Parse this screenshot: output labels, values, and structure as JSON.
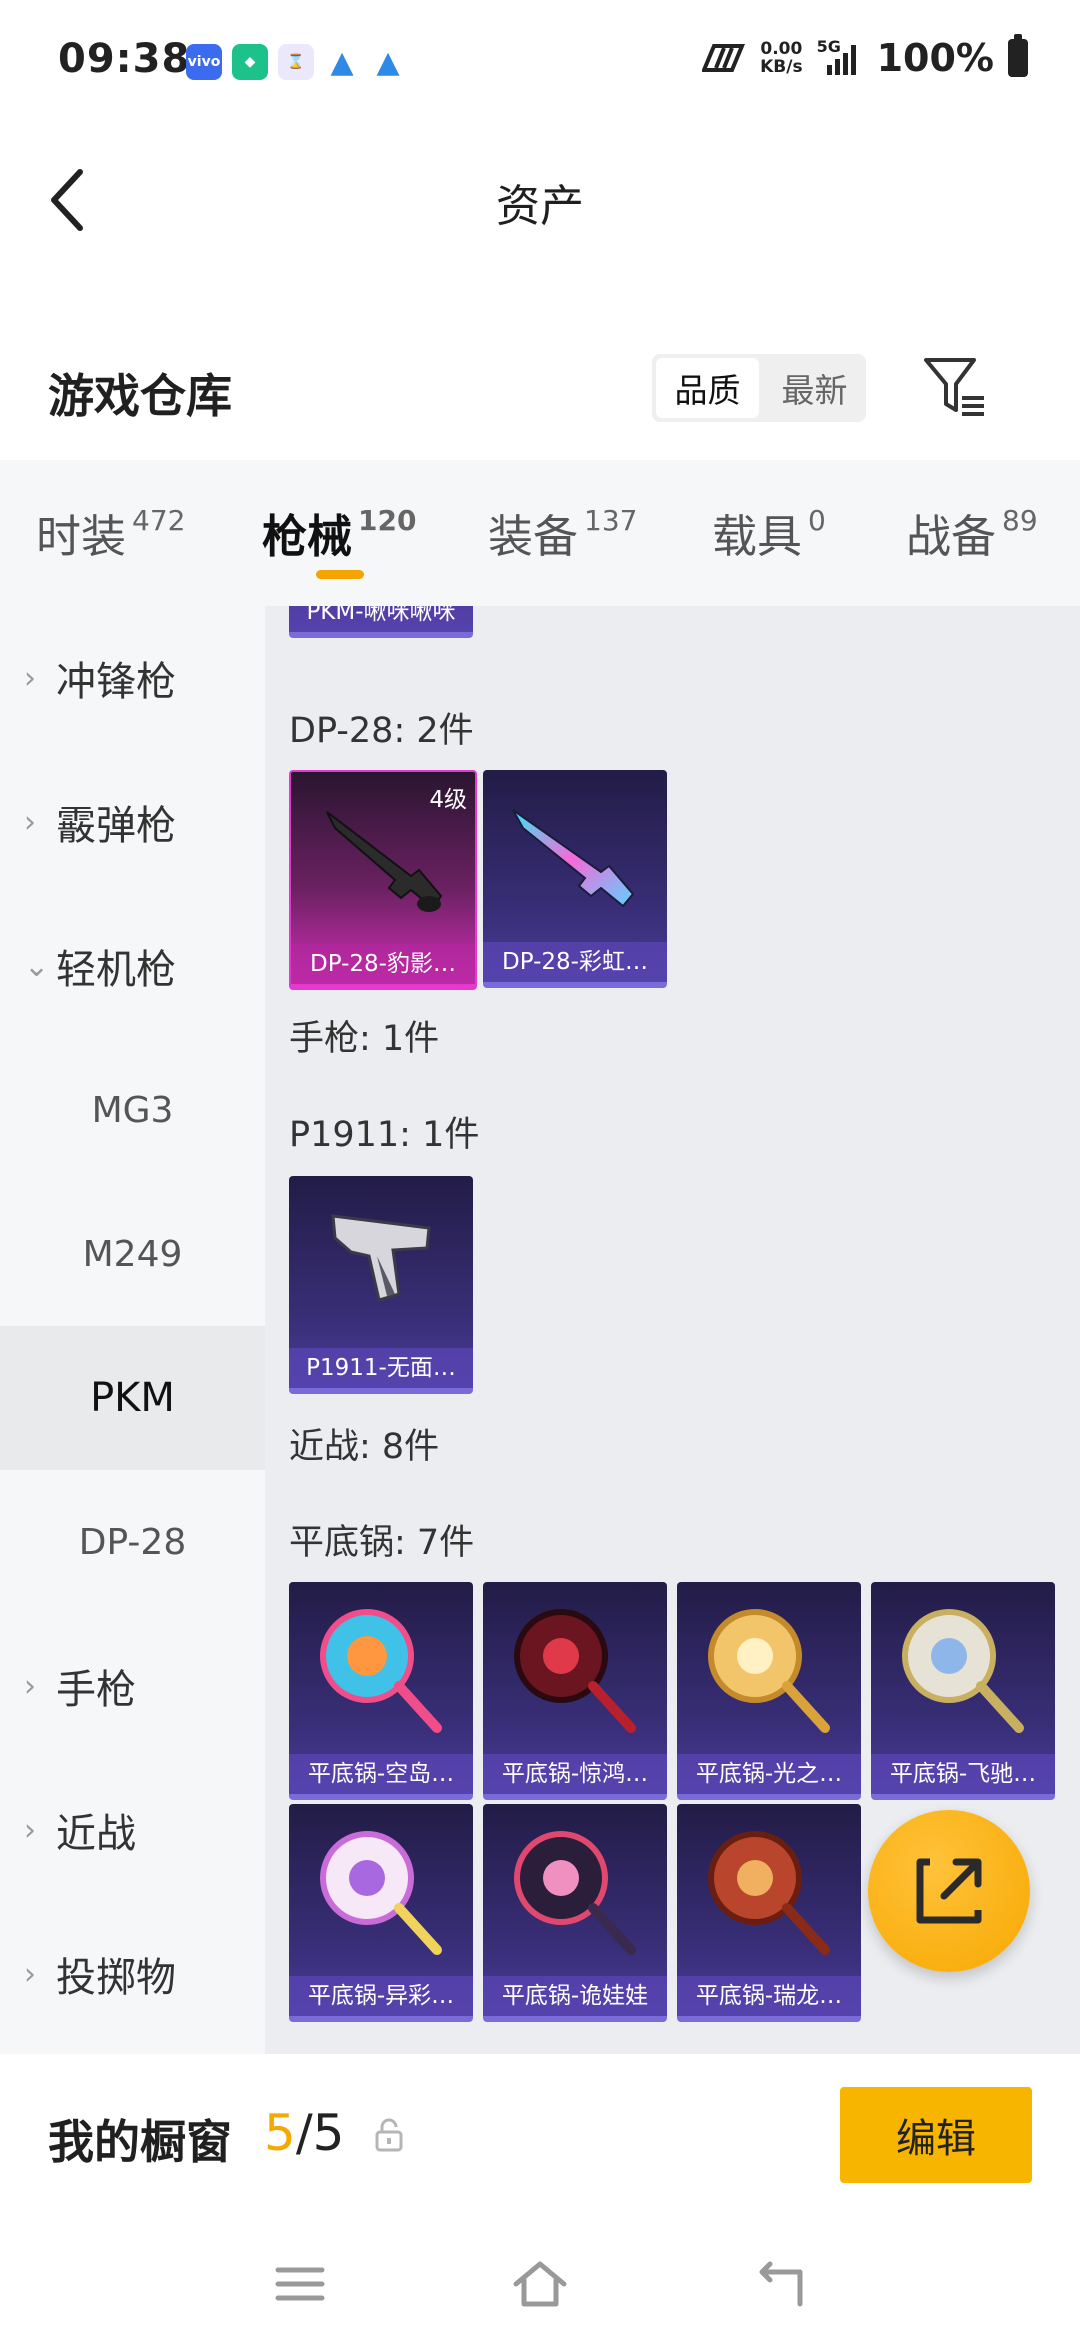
{
  "status": {
    "time": "09:38",
    "speed_value": "0.00",
    "speed_unit": "KB/s",
    "network": "5G",
    "battery": "100%"
  },
  "header": {
    "title": "资产"
  },
  "warehouse": {
    "title": "游戏仓库",
    "sort_options": [
      "品质",
      "最新"
    ],
    "active_sort": "品质"
  },
  "tabs": [
    {
      "label": "时装",
      "count": "472"
    },
    {
      "label": "枪械",
      "count": "120",
      "active": true
    },
    {
      "label": "装备",
      "count": "137"
    },
    {
      "label": "载具",
      "count": "0"
    },
    {
      "label": "战备",
      "count": "89"
    }
  ],
  "sidebar": [
    {
      "label": "冲锋枪",
      "type": "group"
    },
    {
      "label": "霰弹枪",
      "type": "group"
    },
    {
      "label": "轻机枪",
      "type": "group",
      "expanded": true
    },
    {
      "label": "MG3",
      "type": "sub"
    },
    {
      "label": "M249",
      "type": "sub"
    },
    {
      "label": "PKM",
      "type": "sub",
      "selected": true
    },
    {
      "label": "DP-28",
      "type": "sub"
    },
    {
      "label": "手枪",
      "type": "group"
    },
    {
      "label": "近战",
      "type": "group"
    },
    {
      "label": "投掷物",
      "type": "group"
    }
  ],
  "content": {
    "top_card": "PKM-啾咪啾咪",
    "dp28_header": "DP-28: 2件",
    "dp28_items": [
      {
        "name": "DP-28-豹影…",
        "level": "4级",
        "rarity": "legendary"
      },
      {
        "name": "DP-28-彩虹…"
      }
    ],
    "pistol_header": "手枪: 1件",
    "p1911_header": "P1911: 1件",
    "p1911_items": [
      {
        "name": "P1911-无面…"
      }
    ],
    "melee_header": "近战: 8件",
    "pan_header": "平底锅: 7件",
    "pan_items": [
      {
        "name": "平底锅-空岛…"
      },
      {
        "name": "平底锅-惊鸿…"
      },
      {
        "name": "平底锅-光之…"
      },
      {
        "name": "平底锅-飞驰…"
      },
      {
        "name": "平底锅-异彩…"
      },
      {
        "name": "平底锅-诡娃娃"
      },
      {
        "name": "平底锅-瑞龙…"
      }
    ]
  },
  "showcase": {
    "label": "我的橱窗",
    "current": "5",
    "total": "/5",
    "edit_label": "编辑"
  },
  "colors": {
    "accent": "#f7b500",
    "card_bg": "#3a2f7a",
    "legendary": "#d12fb6"
  }
}
